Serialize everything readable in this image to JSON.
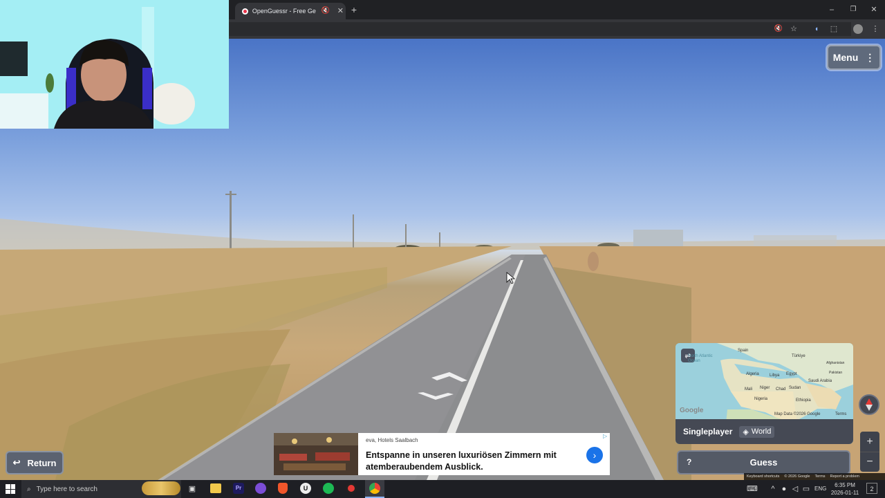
{
  "browser": {
    "tab_title": "OpenGuessr - Free GeoGuessr",
    "new_tab_symbol": "+",
    "close_symbol": "✕"
  },
  "game": {
    "menu_label": "Menu",
    "return_label": "Return",
    "guess_label": "Guess",
    "help_symbol": "?",
    "mode_label": "Singleplayer",
    "region_label": "World"
  },
  "map": {
    "countries": [
      "Spain",
      "Türkiye",
      "Afghanistan",
      "Algeria",
      "Libya",
      "Egypt",
      "Saudi Arabia",
      "Pakistan",
      "Mali",
      "Niger",
      "Chad",
      "Sudan",
      "Nigeria",
      "Ethiopia"
    ],
    "ocean_label": "North Atlantic Ocean",
    "google_label": "Google",
    "attribution": "Map Data ©2026 Google",
    "terms": "Terms"
  },
  "footer": {
    "keyboard_shortcuts": "Keyboard shortcuts",
    "copyright": "© 2026 Google",
    "terms": "Terms",
    "report": "Report a problem"
  },
  "ad": {
    "advertiser": "eva, Hotels Saalbach",
    "headline_line1": "Entspanne in unseren luxuriösen Zimmern mit",
    "headline_line2": "atemberaubendem Ausblick.",
    "badge": "▷"
  },
  "taskbar": {
    "search_placeholder": "Type here to search",
    "time": "6:35 PM",
    "date": "2026-01-11",
    "language": "ENG",
    "notification_count": "2"
  },
  "zoom": {
    "plus": "+",
    "minus": "−"
  },
  "colors": {
    "panel_bg": "#454954",
    "button_bg": "#545a66",
    "ad_cta": "#1a73e8",
    "chrome_dark": "#202124"
  }
}
